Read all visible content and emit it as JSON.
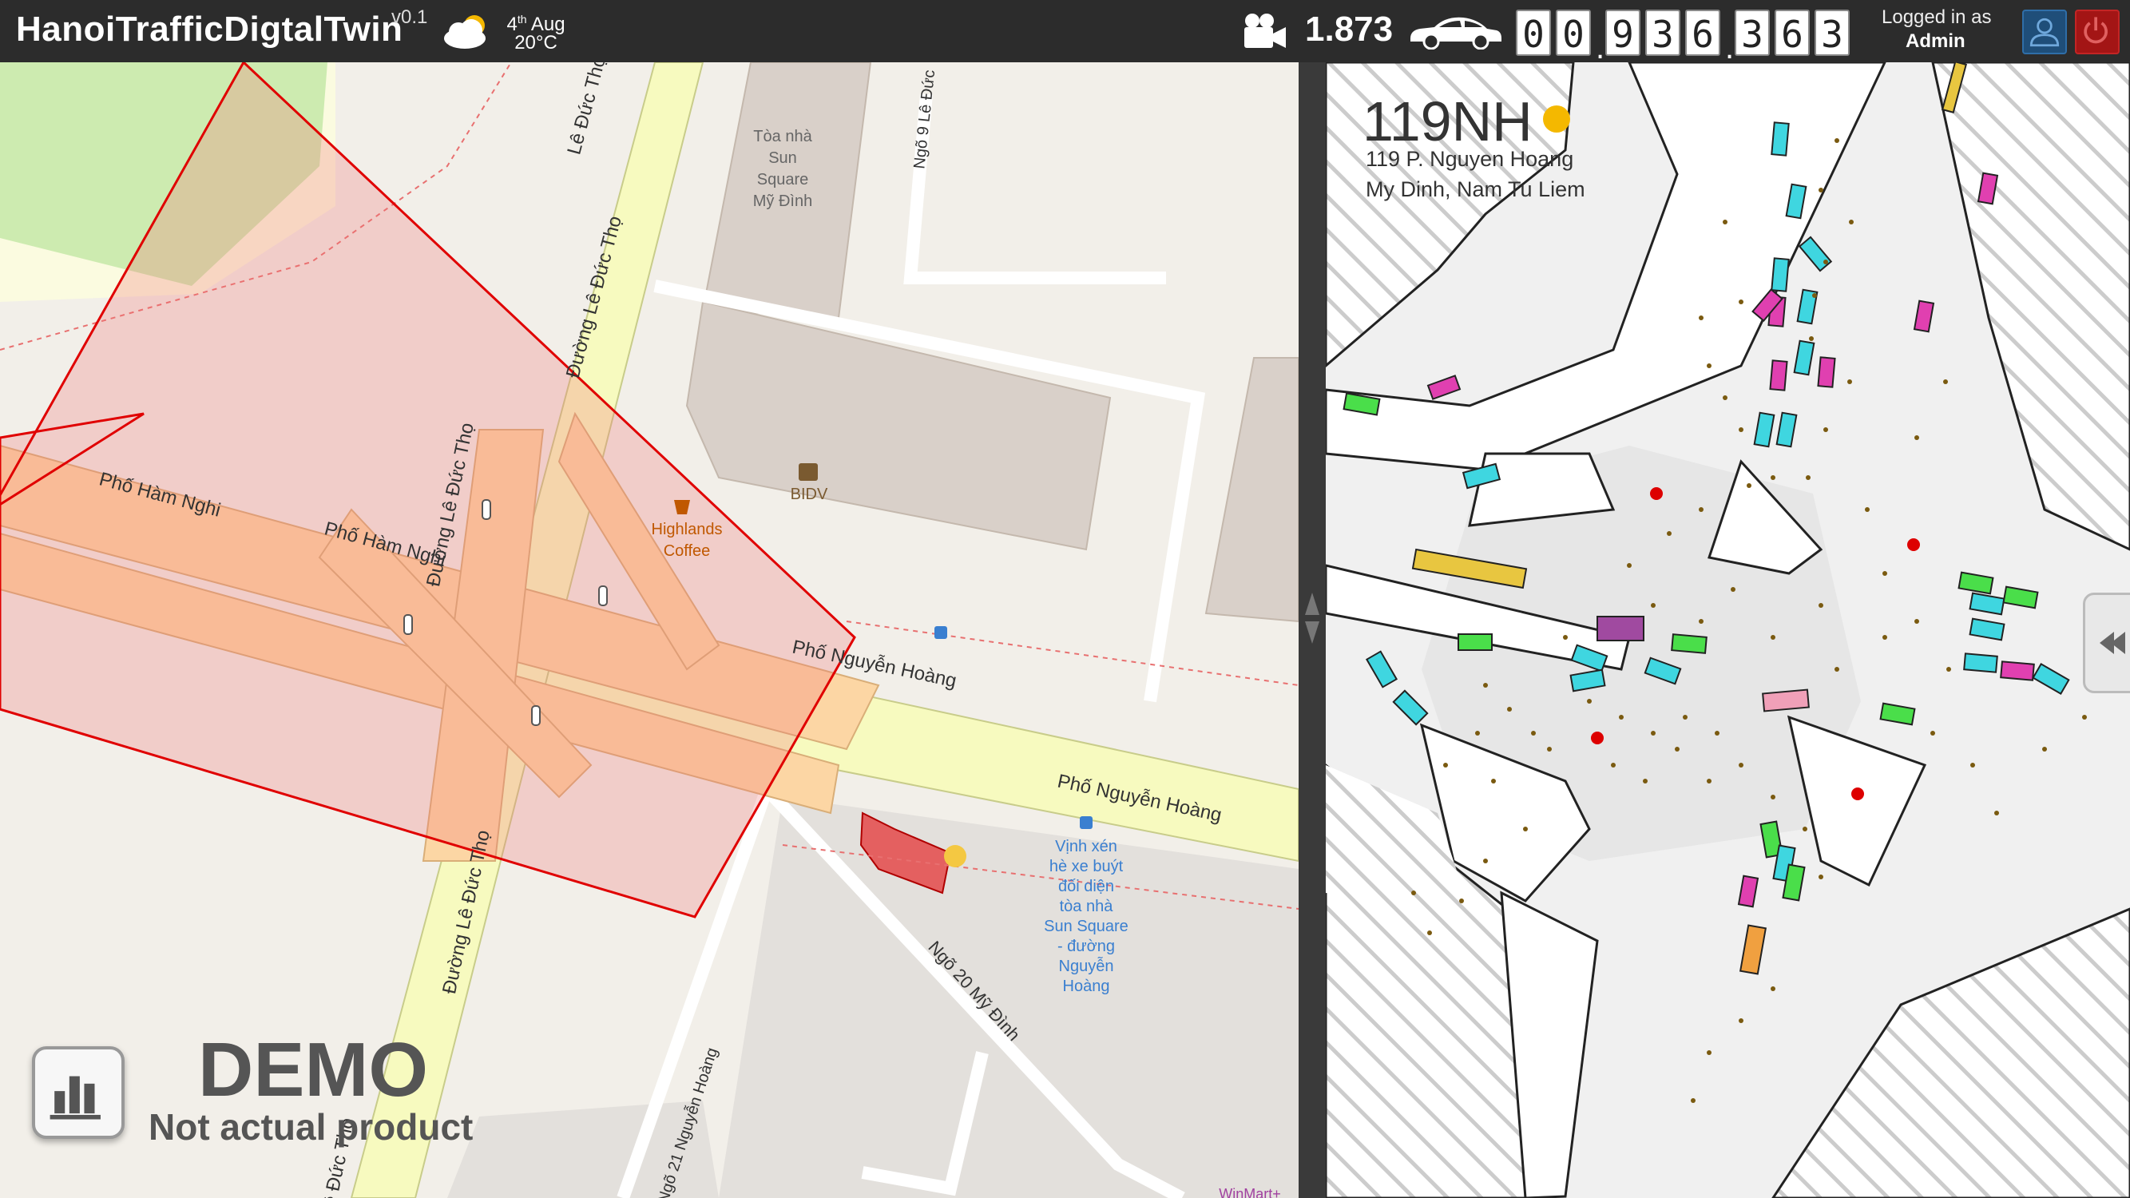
{
  "header": {
    "app_title": "HanoiTrafficDigtalTwin",
    "version": "v0.1",
    "weather": {
      "icon": "cloud-sun-icon",
      "date_day": "4",
      "date_suffix": "th",
      "date_month": "Aug",
      "temperature": "20°C"
    },
    "camera": {
      "icon": "camera-icon",
      "count": "1.873"
    },
    "vehicle_icon": "car-icon",
    "odometer_digits": [
      "0",
      "0",
      "9",
      "3",
      "6",
      "3",
      "6",
      "3"
    ],
    "login": {
      "label": "Logged in as",
      "user": "Admin"
    },
    "colors": {
      "bar": "#2c2c2c",
      "user_button": "#1f4e79",
      "power_button": "#a31515"
    }
  },
  "map": {
    "street_labels": {
      "ham_nghi_1": "Phố Hàm Nghi",
      "ham_nghi_2": "Phố Hàm Nghi",
      "le_duc_tho_top": "Lê Đức Thọ",
      "le_duc_tho_mid": "Đường Lê Đức Thọ",
      "le_duc_tho_left": "Đường Lê Đức Thọ",
      "le_duc_tho_bottom": "Đường Lê Đức Thọ",
      "le_duc_tho_edge": "Lê Đức Thọ",
      "nguyen_hoang_1": "Phố Nguyễn Hoàng",
      "nguyen_hoang_2": "Phố Nguyễn Hoàng",
      "ngo_9": "Ngõ 9 Lê Đức",
      "ngo_20": "Ngõ 20 Mỹ Đình",
      "ngo_21": "Ngõ 21 Nguyễn Hoàng"
    },
    "pois": {
      "sun_square": [
        "Tòa nhà",
        "Sun",
        "Square",
        "Mỹ Đình"
      ],
      "bidv": "BIDV",
      "highlands": [
        "Highlands",
        "Coffee"
      ],
      "bus_stop": [
        "Vịnh xén",
        "hè xe buýt",
        "đối diện",
        "tòa nhà",
        "Sun Square",
        "- đường",
        "Nguyễn",
        "Hoàng"
      ],
      "winmart": "WinMart+"
    },
    "colors": {
      "background": "#f2efe9",
      "primary_road": "#fcd6a4",
      "secondary_road": "#f7fabf",
      "selection": "#e00000",
      "park": "#cdebb0",
      "building": "#d9d0c9"
    }
  },
  "simulation": {
    "intersection_code": "119NH",
    "status_color": "#f4b800",
    "address_line1": "119 P. Nguyen Hoang",
    "address_line2": "My Dinh, Nam Tu Liem",
    "vehicle_colors": [
      "#3fd6e0",
      "#e040b0",
      "#4ade4a",
      "#e8c640",
      "#a04aa0",
      "#f0a0b8",
      "#f0a040"
    ]
  },
  "overlay": {
    "stats_icon": "bar-chart-icon",
    "demo_title": "DEMO",
    "demo_subtitle": "Not actual product"
  }
}
